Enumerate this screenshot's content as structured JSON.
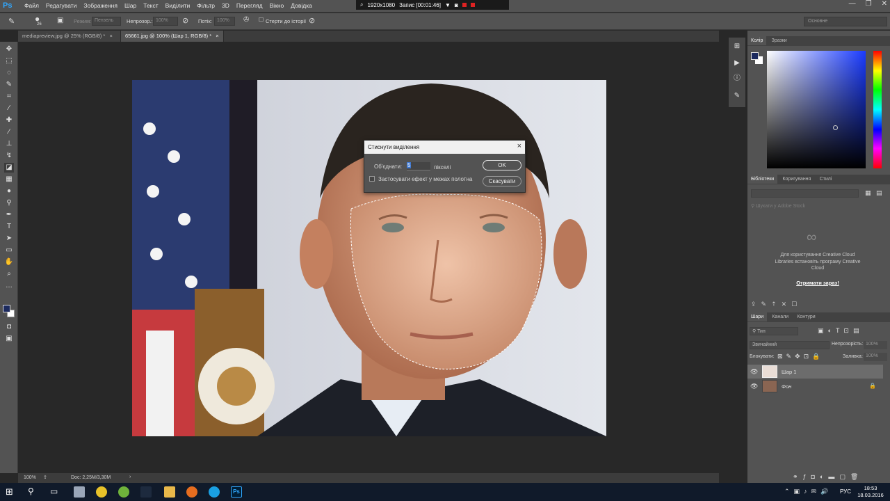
{
  "app": {
    "logo": "Ps",
    "menu": [
      "Файл",
      "Редагувати",
      "Зображення",
      "Шар",
      "Текст",
      "Виділити",
      "Фільтр",
      "3D",
      "Перегляд",
      "Вікно",
      "Довідка"
    ]
  },
  "recorder": {
    "resolution": "1920x1080",
    "status": "Запис [00:01:46]"
  },
  "options_bar": {
    "brush_size": "26",
    "mode_label": "Режим:",
    "mode_value": "Пензель",
    "opacity_label": "Непрозор.:",
    "opacity_value": "100%",
    "flow_label": "Потік:",
    "flow_value": "100%",
    "erase_history": "Стерти до історії",
    "workspace": "Основне"
  },
  "tabs": [
    {
      "label": "mediapreview.jpg @ 25% (RGB/8) *",
      "close": "×"
    },
    {
      "label": "65661.jpg @ 100% (Шар 1, RGB/8) *",
      "close": "×"
    }
  ],
  "status_bar": {
    "zoom": "100%",
    "doc": "Doc: 2,25M/3,30M"
  },
  "dialog": {
    "title": "Стиснути виділення",
    "close": "×",
    "merge_label": "Об'єднати:",
    "merge_value": "5",
    "unit": "пікселі",
    "checkbox_label": "Застосувати ефект у межах полотна",
    "ok": "OK",
    "cancel": "Скасувати"
  },
  "panels": {
    "color_tabs": [
      "Колір",
      "Зразки"
    ],
    "library_tabs": [
      "Бібліотеки",
      "Коригування",
      "Стилі"
    ],
    "library_search": "Шукати у Adobe Stock",
    "library_message": "Для користування Creative Cloud Libraries встановіть програму Creative Cloud",
    "library_link": "Отримати зараз!",
    "layers_tabs": [
      "Шари",
      "Канали",
      "Контури"
    ],
    "layers_kind": "Тип",
    "blend_mode": "Звичайний",
    "opacity_label": "Непрозорість:",
    "opacity_value": "100%",
    "lock_label": "Блокувати:",
    "fill_label": "Заливка:",
    "fill_value": "100%",
    "layers": [
      {
        "name": "Шар 1",
        "selected": true
      },
      {
        "name": "Фон",
        "locked": true
      }
    ]
  },
  "taskbar": {
    "lang": "РУС",
    "time": "18:53",
    "date": "18.03.2016"
  },
  "colors": {
    "foreground": "#1c2a5e",
    "background": "#ffffff",
    "accent": "#31a8ff"
  }
}
